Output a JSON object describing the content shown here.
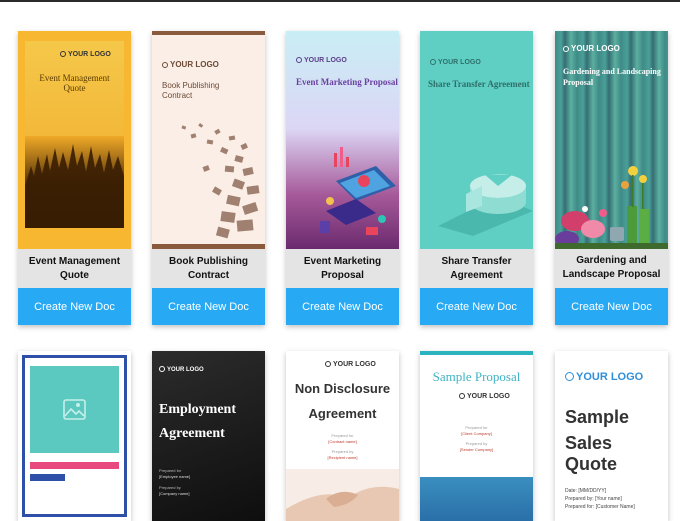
{
  "row1": [
    {
      "title": "Event Management Quote",
      "button": "Create New Doc",
      "logo": "YOUR LOGO",
      "cover_title": "Event Management Quote"
    },
    {
      "title": "Book Publishing Contract",
      "button": "Create New Doc",
      "logo": "YOUR LOGO",
      "cover_title_1": "Book Publishing",
      "cover_title_2": "Contract"
    },
    {
      "title": "Event Marketing Proposal",
      "button": "Create New Doc",
      "logo": "YOUR LOGO",
      "cover_title": "Event Marketing Proposal"
    },
    {
      "title": "Share Transfer Agreement",
      "button": "Create New Doc",
      "logo": "YOUR LOGO",
      "cover_title": "Share Transfer Agreement"
    },
    {
      "title": "Gardening and Landscape Proposal",
      "button": "Create New Doc",
      "logo": "YOUR LOGO",
      "cover_title_1": "Gardening and Landscaping",
      "cover_title_2": "Proposal"
    }
  ],
  "row2": [
    {},
    {
      "logo": "YOUR LOGO",
      "cover_title_1": "Employment",
      "cover_title_2": "Agreement",
      "prepared_for": "Prepared for",
      "prepared_for_value": "[Employee name]",
      "prepared_by": "Prepared by",
      "prepared_by_value": "[Company name]"
    },
    {
      "logo": "YOUR LOGO",
      "cover_title_1": "Non Disclosure",
      "cover_title_2": "Agreement",
      "prepared_for": "Prepared for",
      "prepared_for_value": "[Contract name]",
      "prepared_by": "Prepared by",
      "prepared_by_value": "[Recipient name]"
    },
    {
      "cover_title": "Sample Proposal",
      "logo": "YOUR LOGO",
      "prepared_for": "Prepared for",
      "prepared_for_value": "[Client Company]",
      "prepared_by": "Prepared by",
      "prepared_by_value": "[Sender Company]"
    },
    {
      "logo": "YOUR LOGO",
      "cover_title_1": "Sample",
      "cover_title_2": "Sales Quote",
      "date": "Date: [MM/DD/YY]",
      "prepared_by": "Prepared by: [Your name]",
      "prepared_for": "Prepared for: [Customer Name]"
    }
  ],
  "colors": {
    "button": "#27a9f3",
    "title_bg": "#e4e4e4"
  }
}
